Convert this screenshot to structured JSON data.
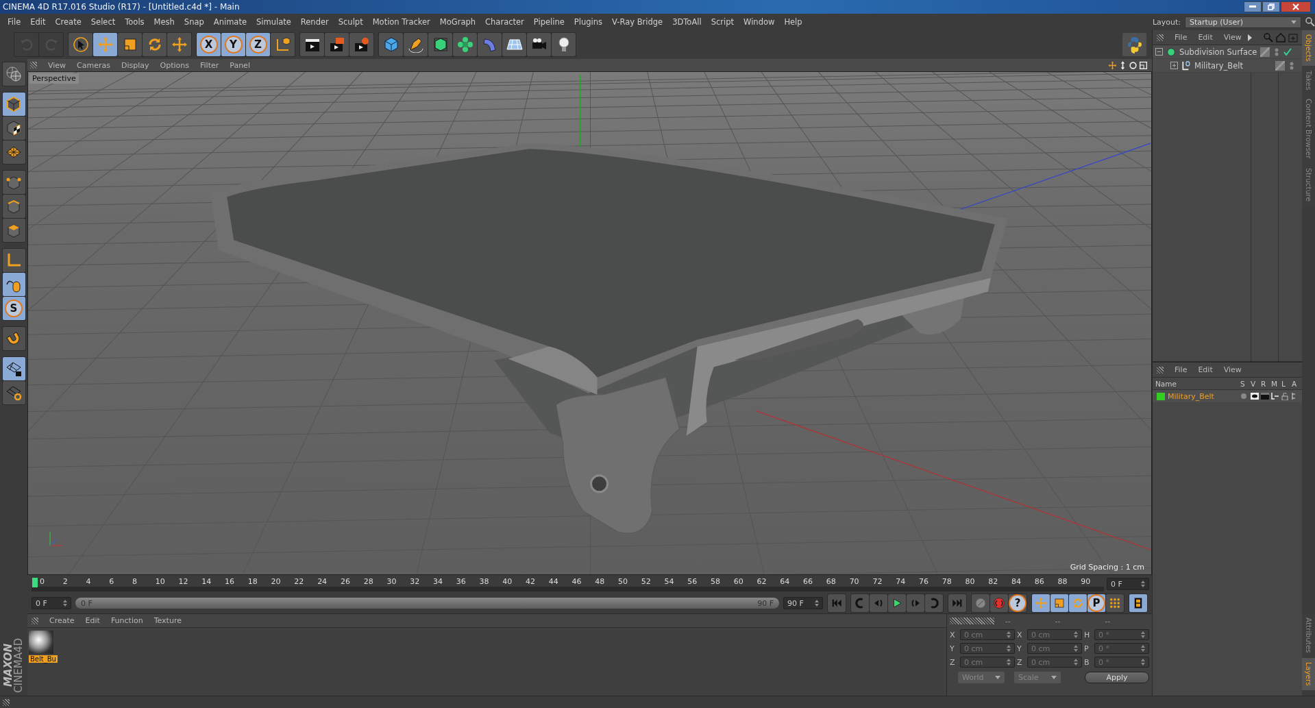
{
  "window": {
    "title": "CINEMA 4D R17.016 Studio (R17) - [Untitled.c4d *] - Main"
  },
  "menu": [
    "File",
    "Edit",
    "Create",
    "Select",
    "Tools",
    "Mesh",
    "Snap",
    "Animate",
    "Simulate",
    "Render",
    "Sculpt",
    "Motion Tracker",
    "MoGraph",
    "Character",
    "Pipeline",
    "Plugins",
    "V-Ray Bridge",
    "3DToAll",
    "Script",
    "Window",
    "Help"
  ],
  "layout": {
    "label": "Layout:",
    "value": "Startup (User)"
  },
  "toolbar_groups": [
    [
      {
        "kind": "undo",
        "active": false,
        "disabled": true
      },
      {
        "kind": "redo",
        "active": false,
        "disabled": true
      }
    ],
    [
      {
        "kind": "select",
        "active": false,
        "disabled": false
      },
      {
        "kind": "move",
        "active": true,
        "disabled": false
      },
      {
        "kind": "scale",
        "active": false,
        "disabled": false
      },
      {
        "kind": "rotate",
        "active": false,
        "disabled": false
      },
      {
        "kind": "move-all",
        "active": false,
        "disabled": false
      }
    ],
    [
      {
        "kind": "axis",
        "label": "X",
        "active": true,
        "disabled": false
      },
      {
        "kind": "axis",
        "label": "Y",
        "active": true,
        "disabled": false
      },
      {
        "kind": "axis",
        "label": "Z",
        "active": true,
        "disabled": false
      },
      {
        "kind": "coord",
        "active": false,
        "disabled": false
      }
    ],
    [
      {
        "kind": "render-view",
        "active": false,
        "disabled": false
      },
      {
        "kind": "render-picture",
        "active": false,
        "disabled": false
      },
      {
        "kind": "render-settings",
        "active": false,
        "disabled": false
      }
    ],
    [
      {
        "kind": "cube",
        "active": false,
        "disabled": false
      },
      {
        "kind": "pen",
        "active": false,
        "disabled": false
      },
      {
        "kind": "subdiv",
        "active": false,
        "disabled": false
      },
      {
        "kind": "cloner",
        "active": false,
        "disabled": false
      },
      {
        "kind": "deformer",
        "active": false,
        "disabled": false
      },
      {
        "kind": "floor",
        "active": false,
        "disabled": false
      },
      {
        "kind": "camera",
        "active": false,
        "disabled": false
      },
      {
        "kind": "light",
        "active": false,
        "disabled": false
      }
    ]
  ],
  "left_tools": [
    [
      {
        "kind": "globe",
        "active": false
      }
    ],
    [
      {
        "kind": "model",
        "active": true
      },
      {
        "kind": "texture",
        "active": false
      },
      {
        "kind": "workplane",
        "active": false
      }
    ],
    [
      {
        "kind": "points",
        "active": false
      },
      {
        "kind": "edges",
        "active": false
      },
      {
        "kind": "polygons",
        "active": false
      }
    ],
    [
      {
        "kind": "axis-mode",
        "active": false
      },
      {
        "kind": "tweak",
        "active": true
      },
      {
        "kind": "snap",
        "label": "S",
        "active": true
      }
    ],
    [
      {
        "kind": "magnet",
        "active": false
      }
    ],
    [
      {
        "kind": "grid-lock",
        "active": true
      },
      {
        "kind": "grid-sync",
        "active": false
      }
    ]
  ],
  "viewport": {
    "menu": [
      "View",
      "Cameras",
      "Display",
      "Options",
      "Filter",
      "Panel"
    ],
    "camera": "Perspective",
    "grid_spacing": "Grid Spacing : 1 cm"
  },
  "objects_panel": {
    "menu": [
      "File",
      "Edit",
      "View"
    ],
    "tree": [
      {
        "name": "Subdivision Surface",
        "kind": "subdivision",
        "expanded": true,
        "checked": true,
        "children": [
          {
            "name": "Military_Belt",
            "kind": "polygon",
            "expanded": false
          }
        ]
      }
    ]
  },
  "side_tabs": [
    {
      "label": "Objects",
      "selected": true
    },
    {
      "label": "Takes",
      "selected": false
    },
    {
      "label": "Content Browser",
      "selected": false
    },
    {
      "label": "Structure",
      "selected": false
    }
  ],
  "lower_side_tabs": [
    {
      "label": "Attributes",
      "selected": false
    },
    {
      "label": "Layers",
      "selected": true
    }
  ],
  "layers_panel": {
    "menu": [
      "File",
      "Edit",
      "View"
    ],
    "columns": [
      "Name",
      "S",
      "V",
      "R",
      "M",
      "L",
      "A"
    ],
    "rows": [
      {
        "name": "Military_Belt",
        "color": "#33cc22"
      }
    ]
  },
  "timeline": {
    "ticks": [
      "0",
      "2",
      "4",
      "6",
      "8",
      "10",
      "12",
      "14",
      "16",
      "18",
      "20",
      "22",
      "24",
      "26",
      "28",
      "30",
      "32",
      "34",
      "36",
      "38",
      "40",
      "42",
      "44",
      "46",
      "48",
      "50",
      "52",
      "54",
      "56",
      "58",
      "60",
      "62",
      "64",
      "66",
      "68",
      "70",
      "72",
      "74",
      "76",
      "78",
      "80",
      "82",
      "84",
      "86",
      "88",
      "90"
    ],
    "current_frame": "0 F"
  },
  "range": {
    "start": "0 F",
    "slider_start": "0 F",
    "slider_end": "90 F",
    "end": "90 F",
    "level": 1
  },
  "playback_groups": [
    [
      {
        "kind": "first",
        "active": false
      }
    ],
    [
      {
        "kind": "prev-key",
        "active": false
      },
      {
        "kind": "step-back",
        "active": false
      },
      {
        "kind": "play",
        "active": false
      },
      {
        "kind": "step-forward",
        "active": false
      },
      {
        "kind": "next-key",
        "active": false
      }
    ],
    [
      {
        "kind": "last",
        "active": false
      }
    ],
    [
      {
        "kind": "key-off",
        "active": false
      },
      {
        "kind": "record",
        "active": false
      },
      {
        "kind": "auto-key",
        "label": "?",
        "active": false
      }
    ],
    [
      {
        "kind": "move",
        "active": true
      },
      {
        "kind": "scale",
        "active": true
      },
      {
        "kind": "rotate",
        "active": true
      },
      {
        "kind": "param",
        "label": "P",
        "active": true
      },
      {
        "kind": "points-grid",
        "active": false
      }
    ],
    [
      {
        "kind": "film",
        "active": true
      }
    ]
  ],
  "materials": {
    "menu": [
      "Create",
      "Edit",
      "Function",
      "Texture"
    ],
    "items": [
      {
        "name": "Belt_Bu",
        "selected": true
      }
    ]
  },
  "coordinates": {
    "headers": [
      "--",
      "--",
      "--"
    ],
    "rows": [
      {
        "label": "X",
        "position": "0 cm",
        "size_label": "X",
        "size": "0 cm",
        "rotation_label": "H",
        "rotation": "0 °"
      },
      {
        "label": "Y",
        "position": "0 cm",
        "size_label": "Y",
        "size": "0 cm",
        "rotation_label": "P",
        "rotation": "0 °"
      },
      {
        "label": "Z",
        "position": "0 cm",
        "size_label": "Z",
        "size": "0 cm",
        "rotation_label": "B",
        "rotation": "0 °"
      }
    ],
    "mode": "World",
    "transform": "Scale",
    "apply": "Apply"
  },
  "brand": {
    "line1": "MAXON",
    "line2": "CINEMA4D"
  }
}
